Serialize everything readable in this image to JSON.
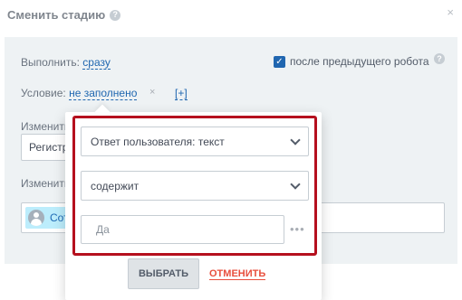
{
  "dialog": {
    "title": "Сменить стадию",
    "help_glyph": "?",
    "close_glyph": "×"
  },
  "form": {
    "execute_label": "Выполнить:",
    "execute_value": "сразу",
    "after_previous_label": "после предыдущего робота",
    "after_previous_checked": true,
    "condition_label": "Условие:",
    "condition_value": "не заполнено",
    "condition_clear": "×",
    "condition_add": "[+]",
    "change_label_1": "Изменить",
    "change_value_1": "Регистр",
    "change_label_2": "Изменить",
    "chip_text": "Сот"
  },
  "condition_popup": {
    "field_select": "Ответ пользователя: текст",
    "operator_select": "содержит",
    "value_placeholder": "Да",
    "more_glyph": "•••",
    "select_button": "ВЫБРАТЬ",
    "cancel_link": "ОТМЕНИТЬ"
  },
  "colors": {
    "accent": "#2067b0",
    "highlight_frame": "#b5101e",
    "cancel": "#e84f3d",
    "chip_bg": "#bcedfc"
  }
}
